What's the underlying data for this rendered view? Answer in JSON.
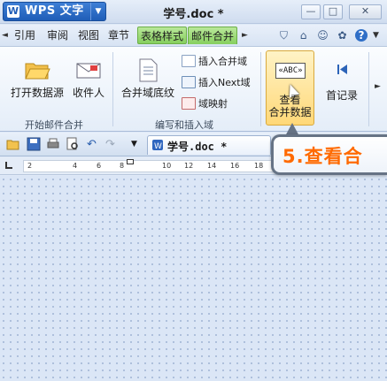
{
  "app": {
    "logo_letter": "W",
    "name": "WPS 文字",
    "dropdown_arrow": "▼"
  },
  "window": {
    "title": "学号.doc *",
    "minimize": "—",
    "maximize": "□",
    "close": "✕"
  },
  "tabs": {
    "left_arrow": "◄",
    "right_arrow": "►",
    "items": [
      {
        "label": "引用"
      },
      {
        "label": "审阅"
      },
      {
        "label": "视图"
      },
      {
        "label": "章节"
      },
      {
        "label": "表格样式"
      },
      {
        "label": "邮件合并"
      }
    ],
    "right_icons": [
      "shirt-icon",
      "home-icon",
      "people-icon",
      "gift-icon",
      "help-icon"
    ],
    "right_glyphs": [
      "⛉",
      "⌂",
      "☺",
      "✿",
      "?"
    ]
  },
  "ribbon": {
    "group1": {
      "label": "开始邮件合并",
      "open_source": "打开数据源",
      "recipient": "收件人"
    },
    "group2": {
      "label": "编写和插入域",
      "merge_shading": "合并域底纹",
      "insert_merge_field": "插入合并域",
      "insert_next_field": "插入Next域",
      "field_mapping": "域映射"
    },
    "view_merge": {
      "line1": "查看",
      "line2": "合并数据",
      "box_text": "«ABC»"
    },
    "first_record": "首记录"
  },
  "quickbar": {
    "doc_tab": "学号.doc *",
    "dropdown": "▼"
  },
  "ruler": {
    "marks": [
      "2",
      "2",
      "4",
      "6",
      "8",
      "10",
      "12",
      "14",
      "16",
      "18"
    ]
  },
  "callout": {
    "text": "5.查看合"
  },
  "colors": {
    "accent_blue": "#1f5db7",
    "tab_green": "#86cf5e",
    "callout_orange": "#ff6a00"
  }
}
